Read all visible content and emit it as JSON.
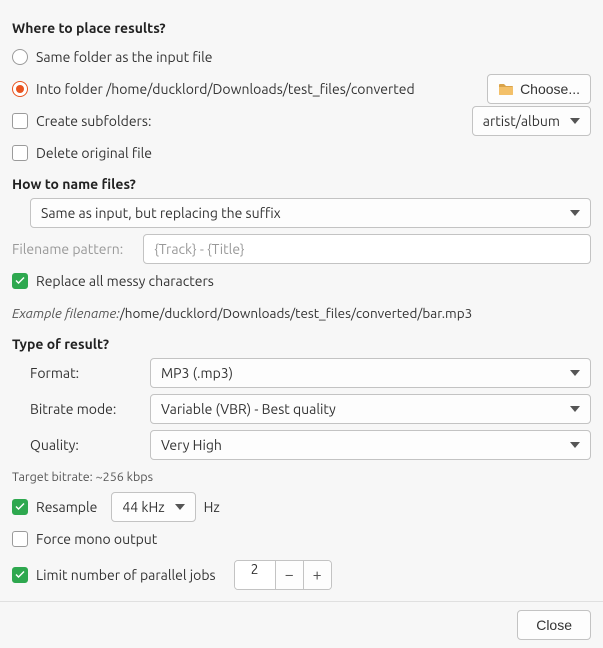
{
  "sections": {
    "place_results": "Where to place results?",
    "name_files": "How to name files?",
    "type_result": "Type of result?"
  },
  "placement": {
    "same_folder_label": "Same folder as the input file",
    "into_folder_prefix": "Into folder ",
    "into_folder_path": "/home/ducklord/Downloads/test_files/converted",
    "choose_button": "Choose...",
    "create_subfolders": "Create subfolders:",
    "subfolder_pattern": "artist/album",
    "delete_original": "Delete original file"
  },
  "naming": {
    "scheme_selected": "Same as input, but replacing the suffix",
    "pattern_label": "Filename pattern:",
    "pattern_placeholder": "{Track} - {Title}",
    "replace_messy": "Replace all messy characters",
    "example_prefix": "Example filename:",
    "example_value": " /home/ducklord/Downloads/test_files/converted/bar.mp3"
  },
  "result": {
    "format_label": "Format:",
    "format_value": "MP3 (.mp3)",
    "bitrate_label": "Bitrate mode:",
    "bitrate_value": "Variable (VBR) - Best quality",
    "quality_label": "Quality:",
    "quality_value": "Very High",
    "target_bitrate": "Target bitrate: ~256 kbps",
    "resample_label": "Resample",
    "resample_value": "44 kHz",
    "resample_unit": "Hz",
    "force_mono": "Force mono output",
    "limit_jobs": "Limit number of parallel jobs",
    "jobs_value": "2"
  },
  "buttons": {
    "close": "Close"
  }
}
